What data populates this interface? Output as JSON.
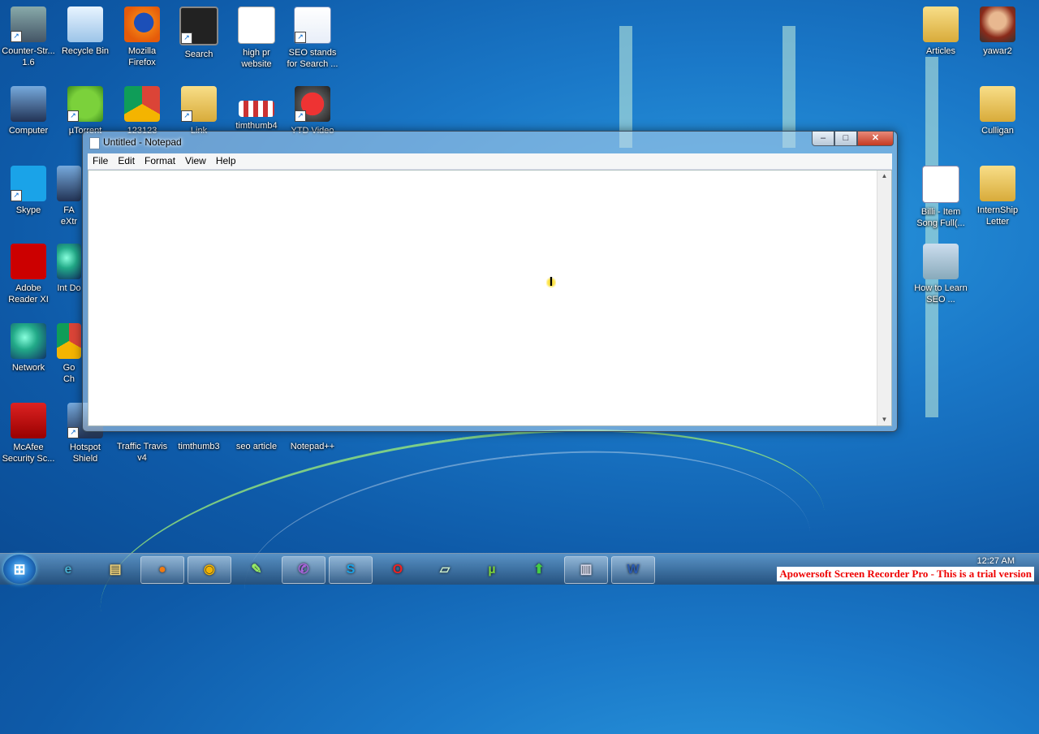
{
  "desktop": {
    "icons": [
      {
        "label": "Counter-Str... 1.6",
        "icon": "counter-strike-icon"
      },
      {
        "label": "Recycle Bin",
        "icon": "recycle-bin-icon"
      },
      {
        "label": "Mozilla Firefox",
        "icon": "firefox-icon"
      },
      {
        "label": "Search",
        "icon": "search-icon"
      },
      {
        "label": "high pr website",
        "icon": "text-document-icon"
      },
      {
        "label": "SEO stands for Search ...",
        "icon": "word-document-icon"
      },
      {
        "label": "Computer",
        "icon": "computer-icon"
      },
      {
        "label": "µTorrent",
        "icon": "utorrent-icon"
      },
      {
        "label": "123123",
        "icon": "chrome-icon"
      },
      {
        "label": "Link",
        "icon": "folder-icon"
      },
      {
        "label": "timthumb4",
        "icon": "image-grid-icon"
      },
      {
        "label": "YTD Video",
        "icon": "ytd-video-icon"
      },
      {
        "label": "Skype",
        "icon": "skype-icon"
      },
      {
        "label": "FA eXtr",
        "icon": "app-icon"
      },
      {
        "label": "Adobe Reader XI",
        "icon": "adobe-reader-icon"
      },
      {
        "label": "Int Do",
        "icon": "app-icon"
      },
      {
        "label": "Network",
        "icon": "network-icon"
      },
      {
        "label": "Go Ch",
        "icon": "chrome-icon"
      },
      {
        "label": "McAfee Security Sc...",
        "icon": "mcafee-icon"
      },
      {
        "label": "Hotspot Shield",
        "icon": "hotspot-shield-icon"
      },
      {
        "label": "Traffic Travis v4",
        "icon": "app-icon"
      },
      {
        "label": "timthumb3",
        "icon": "image-icon"
      },
      {
        "label": "seo article",
        "icon": "text-document-icon"
      },
      {
        "label": "Notepad++",
        "icon": "notepad-plus-icon"
      },
      {
        "label": "Articles",
        "icon": "folder-icon"
      },
      {
        "label": "yawar2",
        "icon": "avatar-photo-icon"
      },
      {
        "label": "Culligan",
        "icon": "folder-icon"
      },
      {
        "label": "Billi - Item Song Full(...",
        "icon": "mp3-file-icon"
      },
      {
        "label": "InternShip Letter",
        "icon": "folder-icon"
      },
      {
        "label": "How to Learn SEO ...",
        "icon": "video-file-icon"
      }
    ]
  },
  "notepad": {
    "title": "Untitled - Notepad",
    "menu": [
      "File",
      "Edit",
      "Format",
      "View",
      "Help"
    ],
    "content": "",
    "buttons": {
      "minimize": "–",
      "maximize": "□",
      "close": "✕"
    }
  },
  "taskbar": {
    "start_label": "⊞",
    "apps": [
      {
        "name": "Internet Explorer",
        "icon": "internet-explorer-icon",
        "glyph": "e"
      },
      {
        "name": "Windows Explorer",
        "icon": "folder-icon",
        "glyph": "▤"
      },
      {
        "name": "Mozilla Firefox",
        "icon": "firefox-icon",
        "glyph": "●"
      },
      {
        "name": "Google Chrome",
        "icon": "chrome-icon",
        "glyph": "◉"
      },
      {
        "name": "Notepad++",
        "icon": "notepad-plus-icon",
        "glyph": "✎"
      },
      {
        "name": "Viber",
        "icon": "viber-icon",
        "glyph": "✆"
      },
      {
        "name": "Skype",
        "icon": "skype-icon",
        "glyph": "S"
      },
      {
        "name": "Opera",
        "icon": "opera-icon",
        "glyph": "O"
      },
      {
        "name": "Sticky Notes",
        "icon": "folder-icon",
        "glyph": "▱"
      },
      {
        "name": "µTorrent",
        "icon": "utorrent-icon",
        "glyph": "µ"
      },
      {
        "name": "Uploader",
        "icon": "upload-icon",
        "glyph": "⬆"
      },
      {
        "name": "Notepad",
        "icon": "notepad-icon",
        "glyph": "▥"
      },
      {
        "name": "Microsoft Word",
        "icon": "word-icon",
        "glyph": "W"
      }
    ],
    "clock_time": "12:27 AM"
  },
  "watermark": "Apowersoft Screen Recorder Pro - This is a trial version"
}
